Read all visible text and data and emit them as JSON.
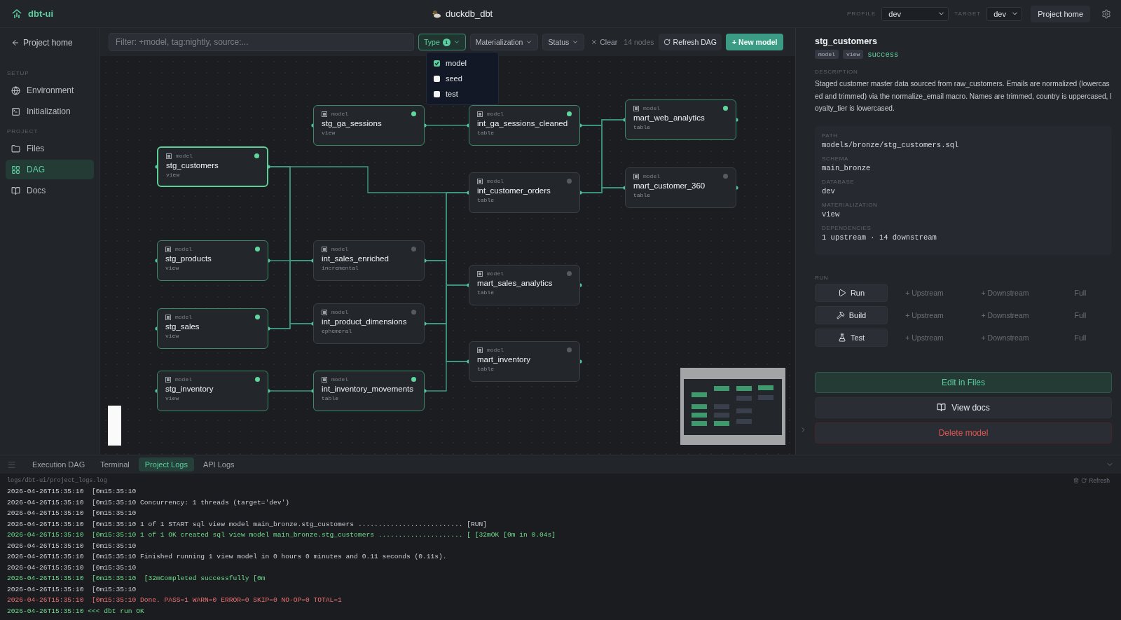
{
  "app": {
    "name": "dbt-ui"
  },
  "project": {
    "name": "duckdb_dbt"
  },
  "header": {
    "profile_label": "PROFILE",
    "profile_value": "dev",
    "target_label": "TARGET",
    "target_value": "dev",
    "home_button": "Project home"
  },
  "sidebar": {
    "back_link": "Project home",
    "sections": [
      {
        "title": "SETUP",
        "items": [
          {
            "label": "Environment",
            "selected": false
          },
          {
            "label": "Initialization",
            "selected": false
          }
        ]
      },
      {
        "title": "PROJECT",
        "items": [
          {
            "label": "Files",
            "selected": false
          },
          {
            "label": "DAG",
            "selected": true
          },
          {
            "label": "Docs",
            "selected": false
          }
        ]
      }
    ]
  },
  "toolbar": {
    "filter_placeholder": "Filter: +model, tag:nightly, source:...",
    "filters": [
      {
        "label": "Type",
        "count": "1",
        "open": true
      },
      {
        "label": "Materialization",
        "open": false
      },
      {
        "label": "Status",
        "open": false
      }
    ],
    "type_menu": [
      {
        "label": "model",
        "checked": true
      },
      {
        "label": "seed",
        "checked": false
      },
      {
        "label": "test",
        "checked": false
      }
    ],
    "clear": "Clear",
    "node_count": "14 nodes",
    "refresh": "Refresh DAG",
    "new_model": "+ New model"
  },
  "nodes": [
    {
      "type": "model",
      "name": "stg_customers",
      "materialization": "view",
      "active": true,
      "selected": true
    },
    {
      "type": "model",
      "name": "stg_products",
      "materialization": "view",
      "active": true,
      "selected": false
    },
    {
      "type": "model",
      "name": "stg_sales",
      "materialization": "view",
      "active": true,
      "selected": false
    },
    {
      "type": "model",
      "name": "stg_inventory",
      "materialization": "view",
      "active": true,
      "selected": false
    },
    {
      "type": "model",
      "name": "stg_ga_sessions",
      "materialization": "view",
      "active": true,
      "selected": false
    },
    {
      "type": "model",
      "name": "int_ga_sessions_cleaned",
      "materialization": "table",
      "active": true,
      "selected": false
    },
    {
      "type": "model",
      "name": "int_customer_orders",
      "materialization": "table",
      "active": false,
      "selected": false
    },
    {
      "type": "model",
      "name": "int_sales_enriched",
      "materialization": "incremental",
      "active": false,
      "selected": false
    },
    {
      "type": "model",
      "name": "int_product_dimensions",
      "materialization": "ephemeral",
      "active": false,
      "selected": false
    },
    {
      "type": "model",
      "name": "int_inventory_movements",
      "materialization": "table",
      "active": true,
      "selected": false
    },
    {
      "type": "model",
      "name": "mart_web_analytics",
      "materialization": "table",
      "active": true,
      "selected": false
    },
    {
      "type": "model",
      "name": "mart_customer_360",
      "materialization": "table",
      "active": false,
      "selected": false
    },
    {
      "type": "model",
      "name": "mart_sales_analytics",
      "materialization": "table",
      "active": false,
      "selected": false
    },
    {
      "type": "model",
      "name": "mart_inventory",
      "materialization": "table",
      "active": false,
      "selected": false
    }
  ],
  "detail": {
    "title": "stg_customers",
    "tags": [
      "model",
      "view"
    ],
    "status": "success",
    "description_label": "DESCRIPTION",
    "description": "Staged customer master data sourced from raw_customers. Emails are normalized (lowercased and trimmed) via the normalize_email macro. Names are trimmed, country is uppercased, loyalty_tier is lowercased.",
    "properties": [
      {
        "label": "PATH",
        "value": "models/bronze/stg_customers.sql"
      },
      {
        "label": "SCHEMA",
        "value": "main_bronze"
      },
      {
        "label": "DATABASE",
        "value": "dev"
      },
      {
        "label": "MATERIALIZATION",
        "value": "view"
      },
      {
        "label": "DEPENDENCIES",
        "value": "1 upstream · 14 downstream"
      }
    ],
    "run_label": "RUN",
    "actions": [
      {
        "label": "Run",
        "upstream": "+ Upstream",
        "downstream": "+ Downstream",
        "full": "Full"
      },
      {
        "label": "Build",
        "upstream": "+ Upstream",
        "downstream": "+ Downstream",
        "full": "Full"
      },
      {
        "label": "Test",
        "upstream": "+ Upstream",
        "downstream": "+ Downstream",
        "full": "Full"
      }
    ],
    "edit_button": "Edit in Files",
    "docs_button": "View docs",
    "delete_button": "Delete model"
  },
  "bottom_panel": {
    "tabs": [
      {
        "label": "Execution DAG",
        "selected": false
      },
      {
        "label": "Terminal",
        "selected": false
      },
      {
        "label": "Project Logs",
        "selected": true
      },
      {
        "label": "API Logs",
        "selected": false
      }
    ],
    "log_path": "logs/dbt-ui/project_logs.log",
    "refresh": "Refresh",
    "lines": [
      {
        "kind": "info",
        "text": "2026-04-26T15:35:10  [0m15:35:10"
      },
      {
        "kind": "info",
        "text": "2026-04-26T15:35:10  [0m15:35:10 Concurrency: 1 threads (target='dev')"
      },
      {
        "kind": "info",
        "text": "2026-04-26T15:35:10  [0m15:35:10"
      },
      {
        "kind": "info",
        "text": "2026-04-26T15:35:10  [0m15:35:10 1 of 1 START sql view model main_bronze.stg_customers .......................... [RUN]"
      },
      {
        "kind": "success",
        "text": "2026-04-26T15:35:10  [0m15:35:10 1 of 1 OK created sql view model main_bronze.stg_customers ..................... [ [32mOK [0m in 0.04s]"
      },
      {
        "kind": "info",
        "text": "2026-04-26T15:35:10  [0m15:35:10"
      },
      {
        "kind": "info",
        "text": "2026-04-26T15:35:10  [0m15:35:10 Finished running 1 view model in 0 hours 0 minutes and 0.11 seconds (0.11s)."
      },
      {
        "kind": "info",
        "text": "2026-04-26T15:35:10  [0m15:35:10"
      },
      {
        "kind": "success",
        "text": "2026-04-26T15:35:10  [0m15:35:10  [32mCompleted successfully [0m"
      },
      {
        "kind": "info",
        "text": "2026-04-26T15:35:10  [0m15:35:10"
      },
      {
        "kind": "error",
        "text": "2026-04-26T15:35:10  [0m15:35:10 Done. PASS=1 WARN=0 ERROR=0 SKIP=0 NO-OP=0 TOTAL=1"
      },
      {
        "kind": "success",
        "text": "2026-04-26T15:35:10 <<< dbt run OK"
      }
    ]
  }
}
